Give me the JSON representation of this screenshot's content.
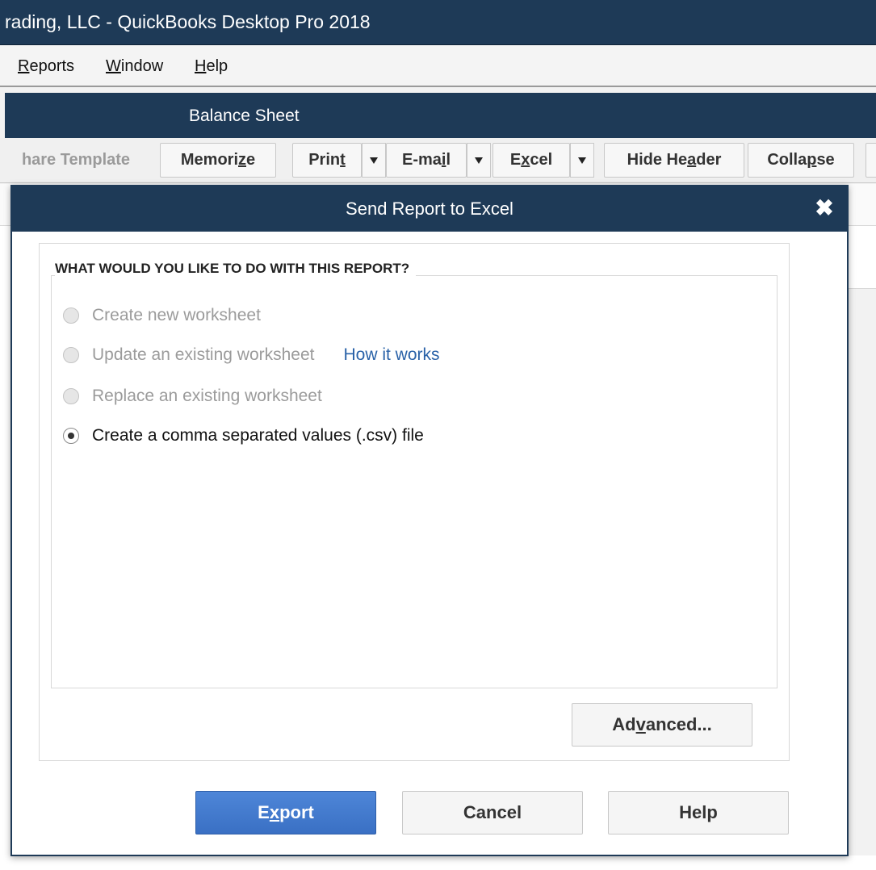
{
  "window": {
    "title": "rading, LLC  - QuickBooks Desktop Pro 2018"
  },
  "menu": {
    "items": [
      {
        "label": "Reports",
        "underline": "R",
        "rest": "eports"
      },
      {
        "label": "Window",
        "underline": "W",
        "rest": "indow"
      },
      {
        "label": "Help",
        "underline": "H",
        "rest": "elp"
      }
    ]
  },
  "report": {
    "title": "Balance Sheet"
  },
  "toolbar": {
    "share_template": "hare Template",
    "memorize": {
      "pre": "Memori",
      "u": "z",
      "post": "e"
    },
    "print": {
      "pre": "Prin",
      "u": "t",
      "post": ""
    },
    "email": {
      "pre": "E-ma",
      "u": "i",
      "post": "l"
    },
    "excel": {
      "pre": "E",
      "u": "x",
      "post": "cel"
    },
    "hide_header": {
      "pre": "Hide He",
      "u": "a",
      "post": "der"
    },
    "collapse": {
      "pre": "Colla",
      "u": "p",
      "post": "se"
    }
  },
  "dialog": {
    "title": "Send Report to Excel",
    "question": "WHAT WOULD YOU LIKE TO DO WITH THIS REPORT?",
    "options": [
      {
        "label": "Create new worksheet",
        "enabled": false,
        "selected": false
      },
      {
        "label": "Update an existing worksheet",
        "enabled": false,
        "selected": false
      },
      {
        "label": "Replace an existing worksheet",
        "enabled": false,
        "selected": false
      },
      {
        "label": "Create a comma separated values (.csv) file",
        "enabled": true,
        "selected": true
      }
    ],
    "how_it_works": "How it works",
    "advanced": {
      "pre": "Ad",
      "u": "v",
      "post": "anced..."
    },
    "export": {
      "pre": "E",
      "u": "x",
      "post": "port"
    },
    "cancel": "Cancel",
    "help": "Help"
  },
  "colors": {
    "title_bar": "#1e3a57",
    "link": "#2a62a8",
    "primary_button": "#3a70c4"
  }
}
